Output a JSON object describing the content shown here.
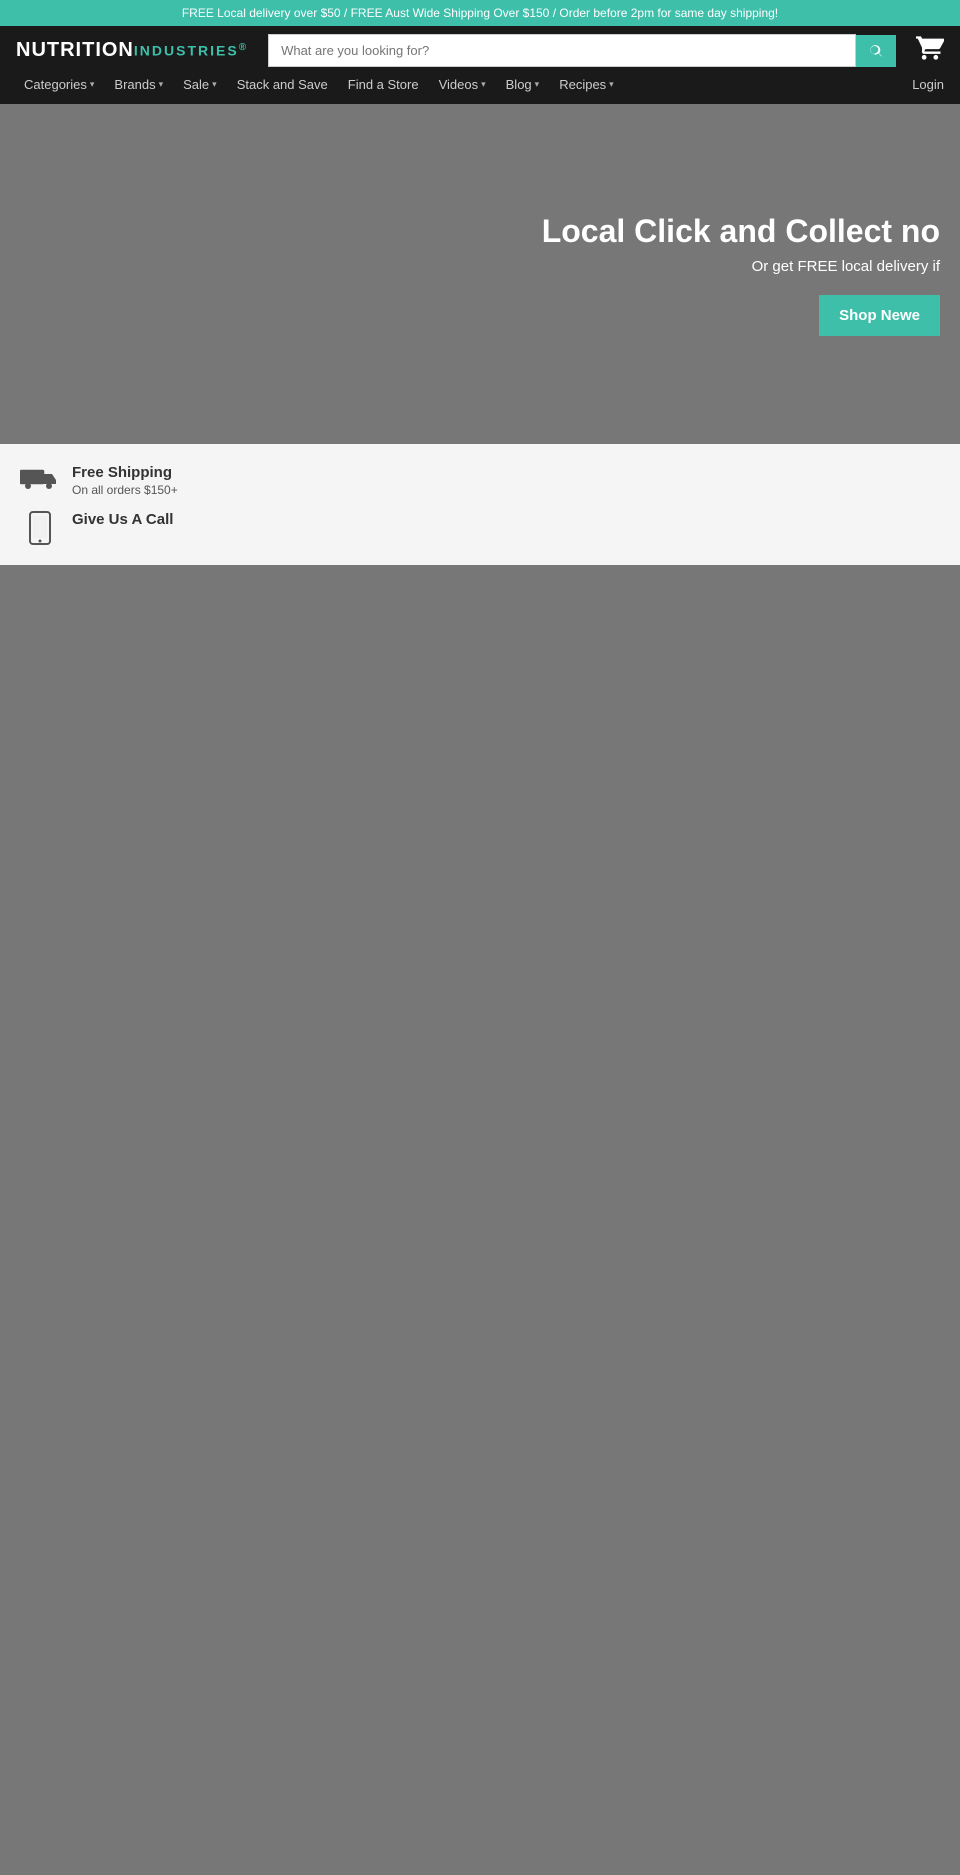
{
  "topBanner": {
    "text": "FREE Local delivery over $50 / FREE Aust Wide Shipping Over $150 / Order before 2pm for same day shipping!"
  },
  "header": {
    "logoNutrition": "NUTRITION",
    "logoIndustries": "INDUSTRIES",
    "logoR": "®",
    "searchPlaceholder": "What are you looking for?",
    "cartLabel": "Cart",
    "loginLabel": "Login",
    "navItems": [
      {
        "label": "Categories",
        "hasChevron": true
      },
      {
        "label": "Brands",
        "hasChevron": true
      },
      {
        "label": "Sale",
        "hasChevron": true
      },
      {
        "label": "Stack and Save",
        "hasChevron": false
      },
      {
        "label": "Find a Store",
        "hasChevron": false
      },
      {
        "label": "Videos",
        "hasChevron": true
      },
      {
        "label": "Blog",
        "hasChevron": true
      },
      {
        "label": "Recipes",
        "hasChevron": true
      }
    ]
  },
  "hero": {
    "title": "Local Click and Collect no",
    "subtitle": "Or get FREE local delivery if",
    "buttonLabel": "Shop Newe"
  },
  "features": [
    {
      "iconType": "truck",
      "title": "Free Shipping",
      "subtitle": "On all orders $150+"
    },
    {
      "iconType": "phone",
      "title": "Give Us A Call",
      "subtitle": ""
    }
  ]
}
